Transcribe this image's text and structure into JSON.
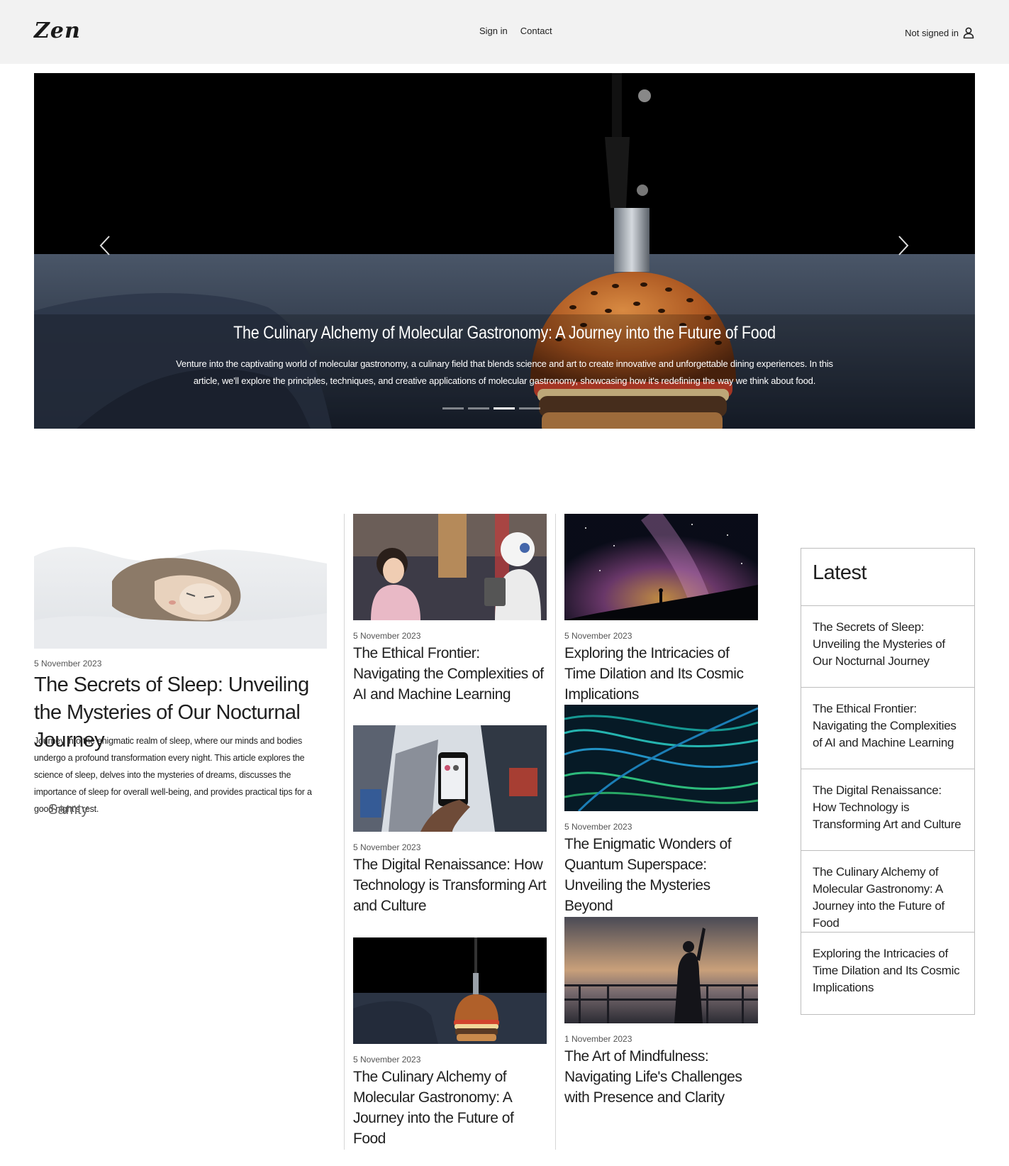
{
  "header": {
    "logo": "Zen",
    "nav": [
      "Sign in",
      "Contact"
    ],
    "signin_status": "Not signed in"
  },
  "hero": {
    "title": "The Culinary Alchemy of Molecular Gastronomy: A Journey into the Future of Food",
    "description": "Venture into the captivating world of molecular gastronomy, a culinary field that blends science and art to create innovative and unforgettable dining experiences. In this article, we'll explore the principles, techniques, and creative applications of molecular gastronomy, showcasing how it's redefining the way we think about food.",
    "slide_count": 4,
    "active_slide": 3
  },
  "feature": {
    "image": "sleeping-cat",
    "date": "5 November 2023",
    "title": "The Secrets of Sleep: Unveiling the Mysteries of Our Nocturnal Journey",
    "excerpt": "Journey into the enigmatic realm of sleep, where our minds and bodies undergo a profound transformation every night. This article explores the science of sleep, delves into the mysteries of dreams, discusses the importance of sleep for overall well-being, and provides practical tips for a good night's rest.",
    "author": "Samty"
  },
  "column1": [
    {
      "image": "girl-and-robot",
      "date": "5 November 2023",
      "title": "The Ethical Frontier: Navigating the Complexities of AI and Machine Learning"
    },
    {
      "image": "smartphone-city",
      "date": "5 November 2023",
      "title": "The Digital Renaissance: How Technology is Transforming Art and Culture"
    },
    {
      "image": "burger-knife",
      "date": "5 November 2023",
      "title": "The Culinary Alchemy of Molecular Gastronomy: A Journey into the Future of Food"
    }
  ],
  "column2": [
    {
      "image": "milky-way",
      "date": "5 November 2023",
      "title": "Exploring the Intricacies of Time Dilation and Its Cosmic Implications"
    },
    {
      "image": "quantum-light",
      "date": "5 November 2023",
      "title": "The Enigmatic Wonders of Quantum Superspace: Unveiling the Mysteries Beyond"
    },
    {
      "image": "sunset-silhouette",
      "date": "1 November 2023",
      "title": "The Art of Mindfulness: Navigating Life's Challenges with Presence and Clarity"
    }
  ],
  "sidebar": {
    "heading": "Latest",
    "items": [
      "The Secrets of Sleep: Unveiling the Mysteries of Our Nocturnal Journey",
      "The Ethical Frontier: Navigating the Complexities of AI and Machine Learning",
      "The Digital Renaissance: How Technology is Transforming Art and Culture",
      "The Culinary Alchemy of Molecular Gastronomy: A Journey into the Future of Food",
      "Exploring the Intricacies of Time Dilation and Its Cosmic Implications"
    ]
  }
}
